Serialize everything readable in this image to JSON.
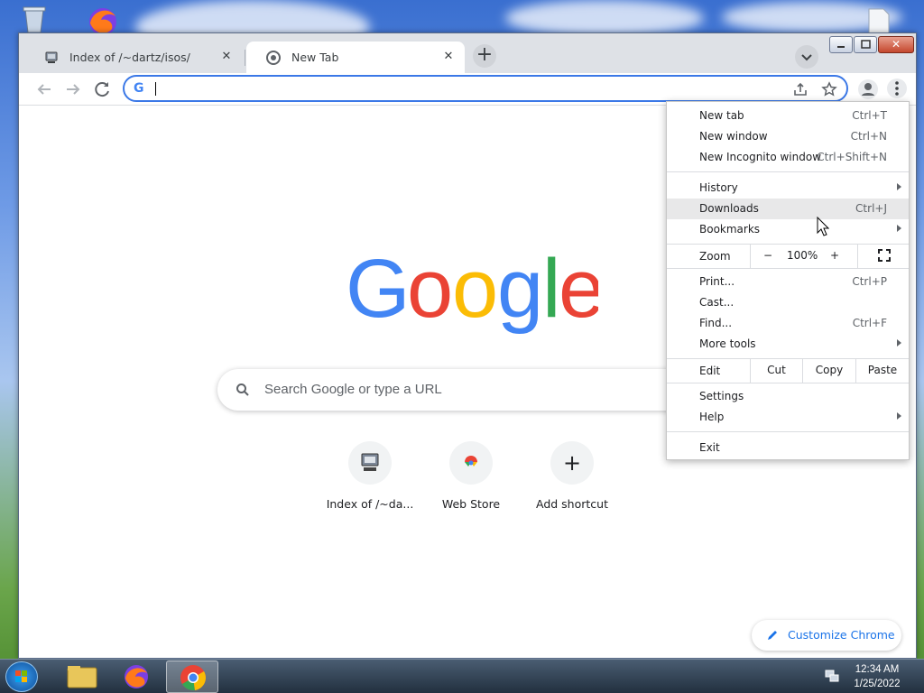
{
  "window": {
    "tabs": [
      {
        "title": "Index of /~dartz/isos/",
        "close": "✕"
      },
      {
        "title": "New Tab",
        "close": "✕"
      }
    ],
    "new_tab": "+",
    "close_glyph": "✕"
  },
  "omnibox": {
    "icon": "G",
    "value": ""
  },
  "page": {
    "search_placeholder": "Search Google or type a URL",
    "shortcuts": [
      {
        "label": "Index of /~da...",
        "icon": "server-icon"
      },
      {
        "label": "Web Store",
        "icon": "webstore-icon"
      },
      {
        "label": "Add shortcut",
        "icon": "plus-icon",
        "glyph": "+"
      }
    ],
    "customize": "Customize Chrome"
  },
  "menu": {
    "new_tab": {
      "label": "New tab",
      "shortcut": "Ctrl+T"
    },
    "new_window": {
      "label": "New window",
      "shortcut": "Ctrl+N"
    },
    "incognito": {
      "label": "New Incognito window",
      "shortcut": "Ctrl+Shift+N"
    },
    "history": {
      "label": "History"
    },
    "downloads": {
      "label": "Downloads",
      "shortcut": "Ctrl+J"
    },
    "bookmarks": {
      "label": "Bookmarks"
    },
    "zoom": {
      "label": "Zoom",
      "minus": "−",
      "value": "100%",
      "plus": "+"
    },
    "print": {
      "label": "Print...",
      "shortcut": "Ctrl+P"
    },
    "cast": {
      "label": "Cast..."
    },
    "find": {
      "label": "Find...",
      "shortcut": "Ctrl+F"
    },
    "more_tools": {
      "label": "More tools"
    },
    "edit": {
      "label": "Edit",
      "cut": "Cut",
      "copy": "Copy",
      "paste": "Paste"
    },
    "settings": {
      "label": "Settings"
    },
    "help": {
      "label": "Help"
    },
    "exit": {
      "label": "Exit"
    }
  },
  "taskbar": {
    "time": "12:34 AM",
    "date": "1/25/2022"
  },
  "colors": {
    "accent": "#1a73e8",
    "omnibox_border": "#3b78e7",
    "hover": "#e8e8e9"
  }
}
